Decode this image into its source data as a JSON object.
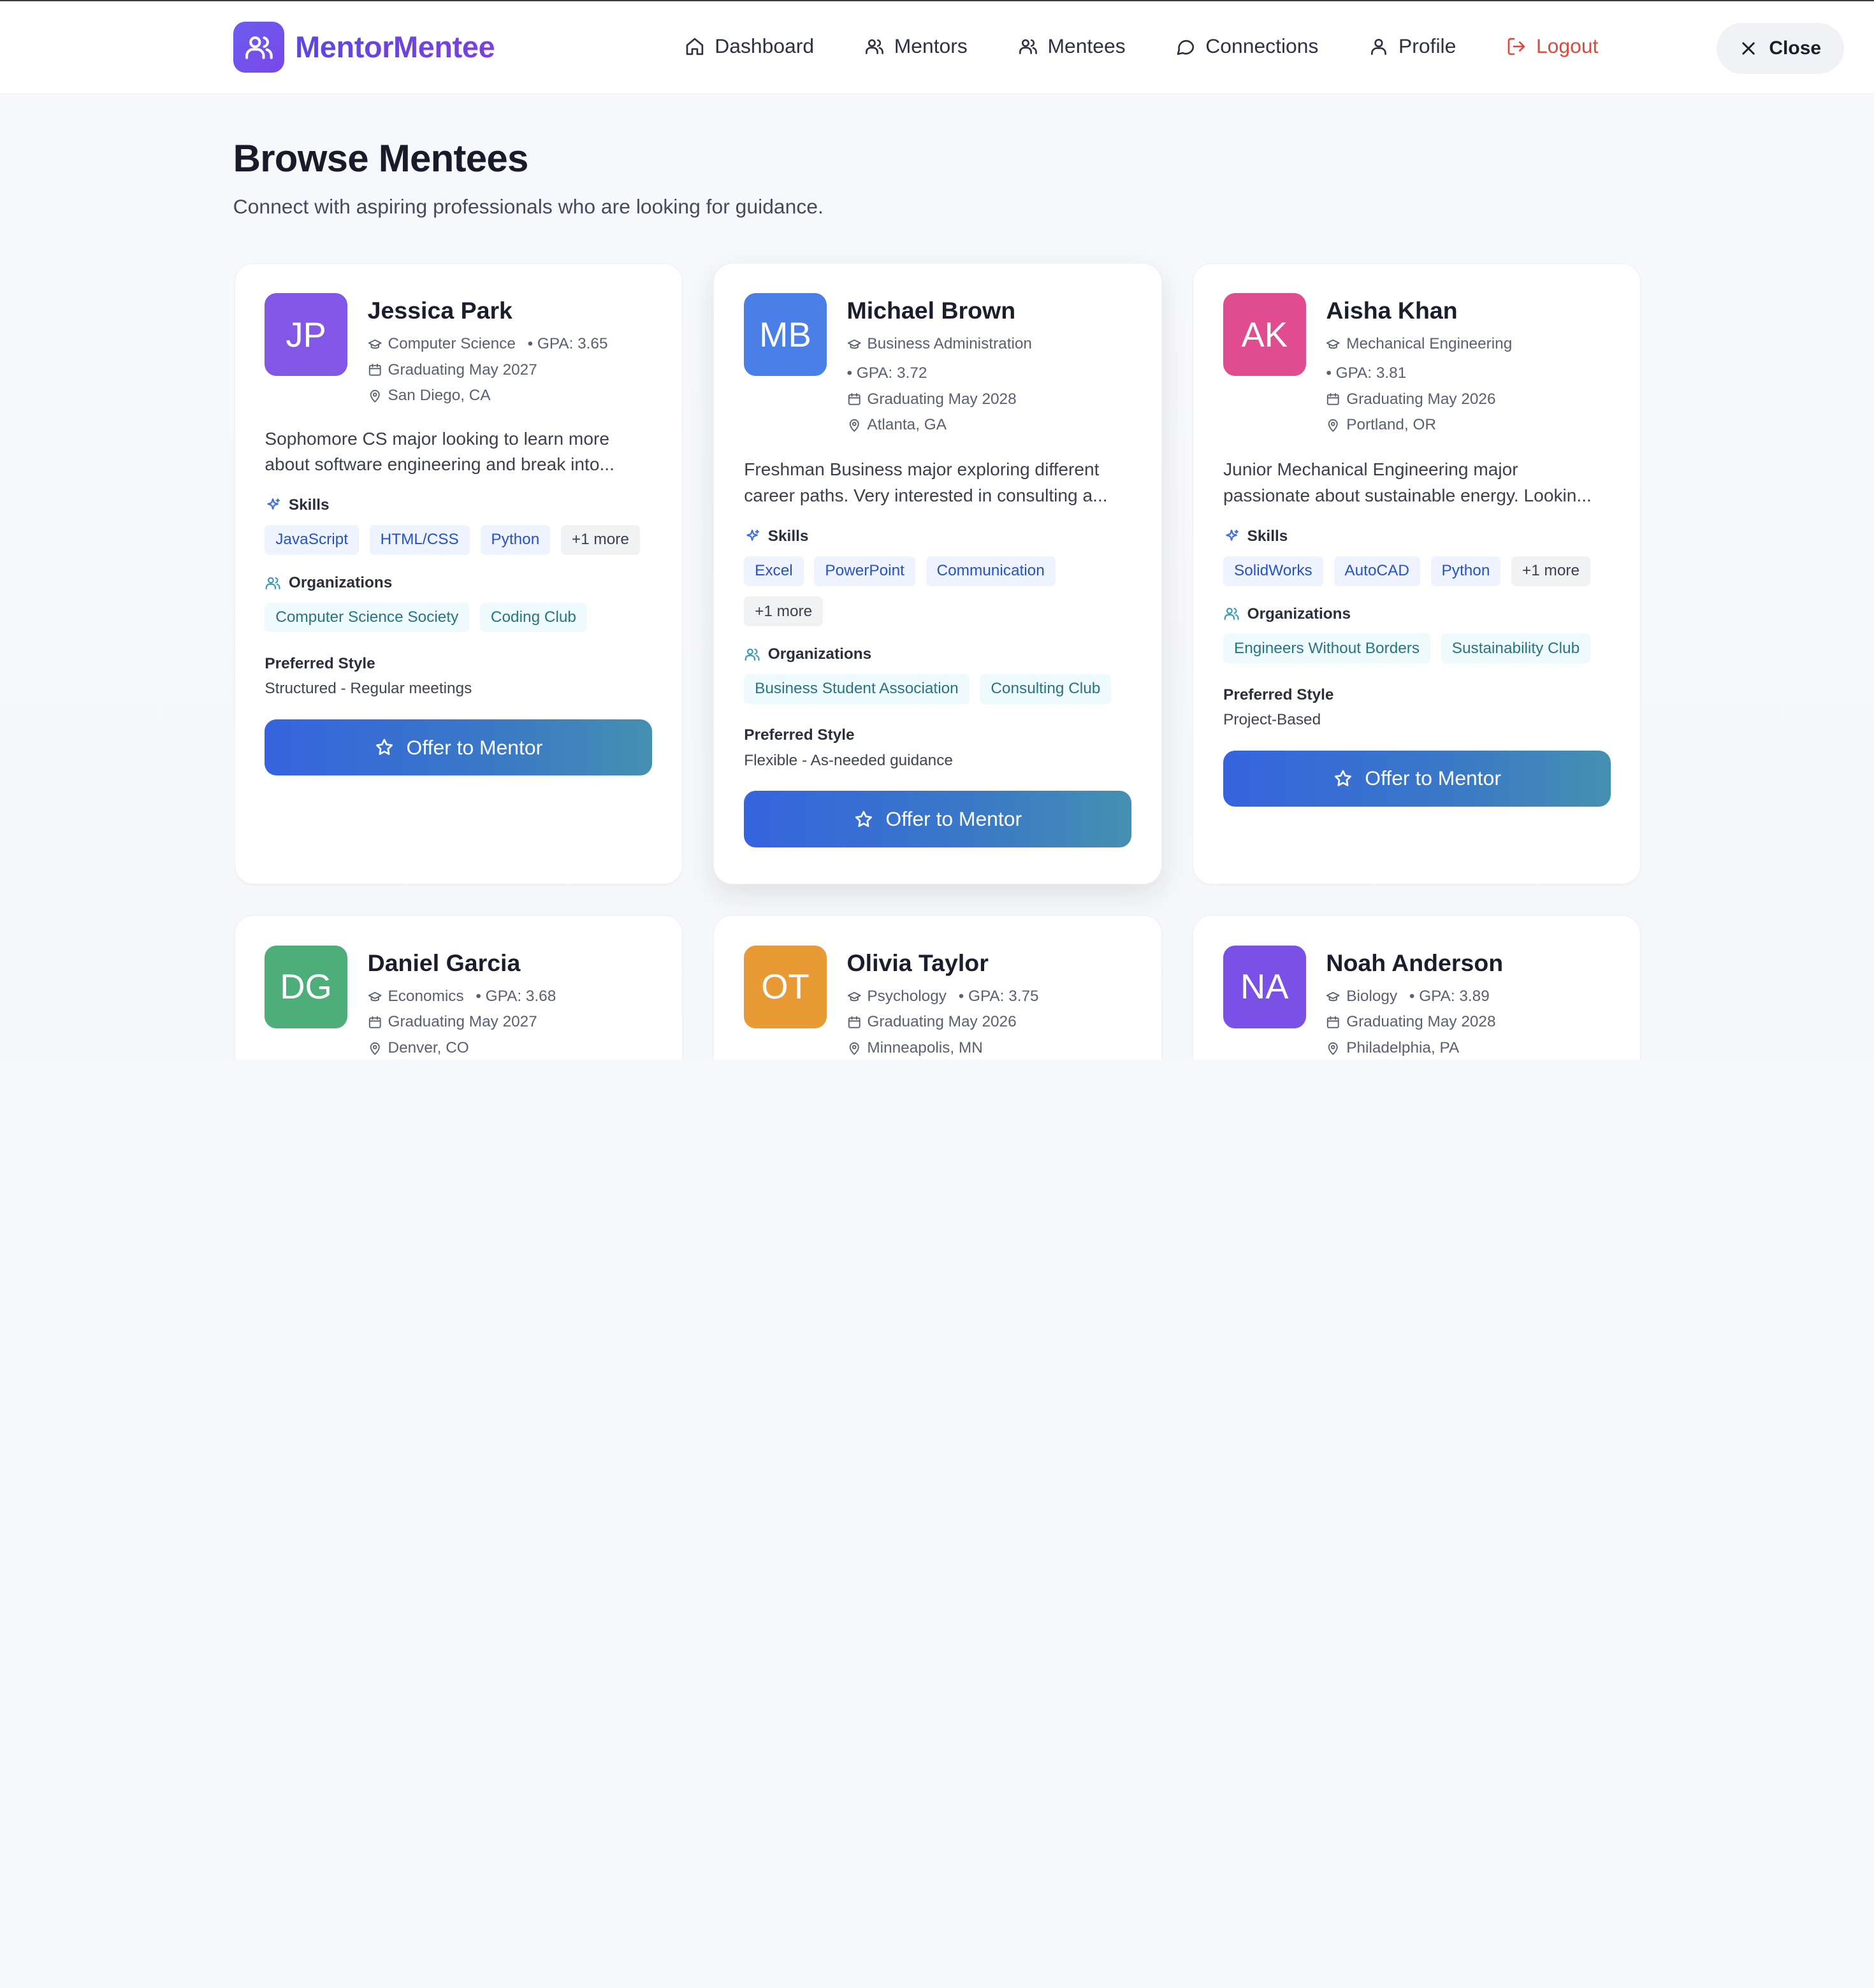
{
  "brand": {
    "name": "MentorMentee"
  },
  "nav": {
    "dashboard": "Dashboard",
    "mentors": "Mentors",
    "mentees": "Mentees",
    "connections": "Connections",
    "profile": "Profile",
    "logout": "Logout"
  },
  "close_label": "Close",
  "page": {
    "title": "Browse Mentees",
    "subtitle": "Connect with aspiring professionals who are looking for guidance."
  },
  "labels": {
    "skills": "Skills",
    "organizations": "Organizations",
    "preferred_style": "Preferred Style",
    "offer": "Offer to Mentor"
  },
  "colors": {
    "brand": "#6b5cf0",
    "logout": "#e0483a",
    "skill_tag": "#2452c9",
    "org_tag": "#287485"
  },
  "mentees": [
    {
      "initials": "JP",
      "avatar_color": "#8257e5",
      "name": "Jessica Park",
      "major": "Computer Science",
      "gpa": "• GPA: 3.65",
      "graduation": "Graduating May 2027",
      "location": "San Diego, CA",
      "bio_line1": "Sophomore CS major looking to learn more",
      "bio_line2": "about software engineering and break into...",
      "skills": [
        "JavaScript",
        "HTML/CSS",
        "Python"
      ],
      "skills_more": "+1 more",
      "orgs": [
        "Computer Science Society",
        "Coding Club"
      ],
      "style": "Structured - Regular meetings"
    },
    {
      "initials": "MB",
      "avatar_color": "#4a7fe8",
      "name": "Michael Brown",
      "major": "Business Administration",
      "gpa": "• GPA: 3.72",
      "graduation": "Graduating May 2028",
      "location": "Atlanta, GA",
      "bio_line1": "Freshman Business major exploring different",
      "bio_line2": "career paths. Very interested in consulting a...",
      "skills": [
        "Excel",
        "PowerPoint",
        "Communication"
      ],
      "skills_more": "+1 more",
      "orgs": [
        "Business Student Association",
        "Consulting Club"
      ],
      "style": "Flexible - As-needed guidance"
    },
    {
      "initials": "AK",
      "avatar_color": "#e04c8f",
      "name": "Aisha Khan",
      "major": "Mechanical Engineering",
      "gpa": "• GPA: 3.81",
      "graduation": "Graduating May 2026",
      "location": "Portland, OR",
      "bio_line1": "Junior Mechanical Engineering major",
      "bio_line2": "passionate about sustainable energy. Lookin...",
      "skills": [
        "SolidWorks",
        "AutoCAD",
        "Python"
      ],
      "skills_more": "+1 more",
      "orgs": [
        "Engineers Without Borders",
        "Sustainability Club"
      ],
      "style": "Project-Based"
    },
    {
      "initials": "DG",
      "avatar_color": "#4dae7a",
      "name": "Daniel Garcia",
      "major": "Economics",
      "gpa": "• GPA: 3.68",
      "graduation": "Graduating May 2027",
      "location": "Denver, CO"
    },
    {
      "initials": "OT",
      "avatar_color": "#e89a35",
      "name": "Olivia Taylor",
      "major": "Psychology",
      "gpa": "• GPA: 3.75",
      "graduation": "Graduating May 2026",
      "location": "Minneapolis, MN"
    },
    {
      "initials": "NA",
      "avatar_color": "#7b50e6",
      "name": "Noah Anderson",
      "major": "Biology",
      "gpa": "• GPA: 3.89",
      "graduation": "Graduating May 2028",
      "location": "Philadelphia, PA"
    }
  ]
}
